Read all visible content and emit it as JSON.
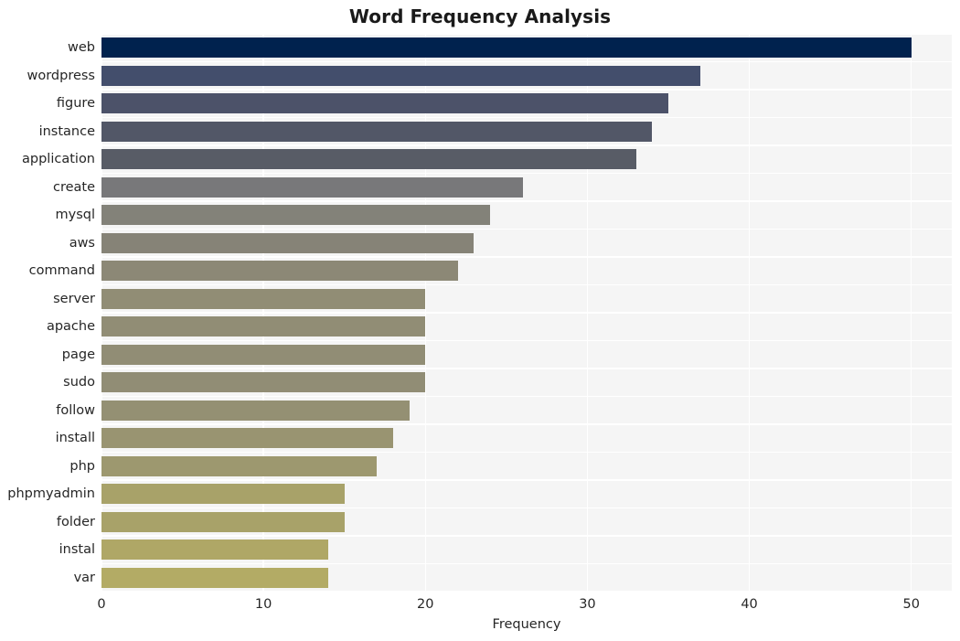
{
  "chart_data": {
    "type": "bar",
    "orientation": "horizontal",
    "title": "Word Frequency Analysis",
    "xlabel": "Frequency",
    "ylabel": "",
    "categories": [
      "web",
      "wordpress",
      "figure",
      "instance",
      "application",
      "create",
      "mysql",
      "aws",
      "command",
      "server",
      "apache",
      "page",
      "sudo",
      "follow",
      "install",
      "php",
      "phpmyadmin",
      "folder",
      "instal",
      "var"
    ],
    "values": [
      50,
      37,
      35,
      34,
      33,
      26,
      24,
      23,
      22,
      20,
      20,
      20,
      20,
      19,
      18,
      17,
      15,
      15,
      14,
      14
    ],
    "bar_colors": [
      "#00224e",
      "#434e6c",
      "#4c5269",
      "#525767",
      "#585c66",
      "#78787a",
      "#838279",
      "#868377",
      "#8c8876",
      "#918d75",
      "#918d75",
      "#918d75",
      "#918d75",
      "#949073",
      "#999471",
      "#9d986f",
      "#a8a269",
      "#a8a269",
      "#afa766",
      "#b3ab65"
    ],
    "xlim": [
      0,
      52.5
    ],
    "xticks": [
      0,
      10,
      20,
      30,
      40,
      50
    ],
    "xticklabels": [
      "0",
      "10",
      "20",
      "30",
      "40",
      "50"
    ],
    "grid": true,
    "grid_color": "#ffffff",
    "plot_background": "#f5f5f5",
    "figure_background": "#ffffff",
    "colormap": "cividis",
    "legend": "none"
  }
}
